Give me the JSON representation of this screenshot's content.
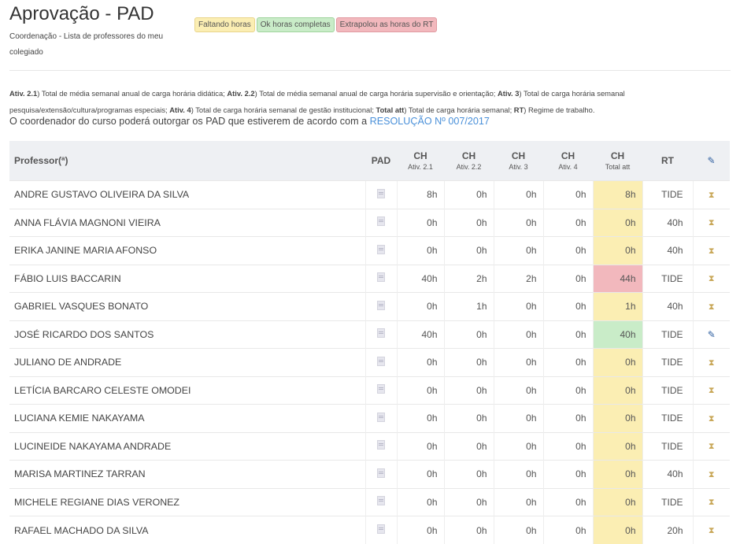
{
  "page": {
    "title": "Aprovação - PAD",
    "subtitle": "Coordenação - Lista de professores do meu colegiado"
  },
  "badges": [
    {
      "label": "Faltando horas",
      "color": "#fbeeb3"
    },
    {
      "label": "Ok horas completas",
      "color": "#c9ecc8"
    },
    {
      "label": "Extrapolou as horas do RT",
      "color": "#f2b8bd"
    }
  ],
  "legend": {
    "a21_key": "Ativ. 2.1",
    "a21_text": ") Total de média semanal anual de carga horária didática; ",
    "a22_key": "Ativ. 2.2",
    "a22_text": ") Total de média semanal anual de carga horária supervisão e orientação; ",
    "a3_key": "Ativ. 3",
    "a3_text": ") Total de carga horária semanal pesquisa/extensão/cultura/programas especiais; ",
    "a4_key": "Ativ. 4",
    "a4_text": ") Total de carga horária semanal de gestão institucional; ",
    "tot_key": "Total att",
    "tot_text": ") Total de carga horária semanal; ",
    "rt_key": "RT",
    "rt_text": ") Regime de trabalho."
  },
  "note": {
    "text": "O coordenador do curso poderá outorgar os PAD que estiverem de acordo com a ",
    "link": "RESOLUÇÃO Nº 007/2017"
  },
  "table": {
    "headers": {
      "professor": "Professor(ª)",
      "pad": "PAD",
      "ch": "CH",
      "a21": "Ativ. 2.1",
      "a22": "Ativ. 2.2",
      "a3": "Ativ. 3",
      "a4": "Ativ. 4",
      "total": "Total att",
      "rt": "RT",
      "action_icon": "pencil-icon"
    },
    "rows": [
      {
        "name": "ANDRE GUSTAVO OLIVEIRA DA SILVA",
        "a21": "8h",
        "a22": "0h",
        "a3": "0h",
        "a4": "0h",
        "total": "8h",
        "status": "yellow",
        "rt": "TIDE",
        "action": "hourglass-icon"
      },
      {
        "name": "ANNA FLÁVIA MAGNONI VIEIRA",
        "a21": "0h",
        "a22": "0h",
        "a3": "0h",
        "a4": "0h",
        "total": "0h",
        "status": "yellow",
        "rt": "40h",
        "action": "hourglass-icon"
      },
      {
        "name": "ERIKA JANINE MARIA AFONSO",
        "a21": "0h",
        "a22": "0h",
        "a3": "0h",
        "a4": "0h",
        "total": "0h",
        "status": "yellow",
        "rt": "40h",
        "action": "hourglass-icon"
      },
      {
        "name": "FÁBIO LUIS BACCARIN",
        "a21": "40h",
        "a22": "2h",
        "a3": "2h",
        "a4": "0h",
        "total": "44h",
        "status": "red",
        "rt": "TIDE",
        "action": "hourglass-icon"
      },
      {
        "name": "GABRIEL VASQUES BONATO",
        "a21": "0h",
        "a22": "1h",
        "a3": "0h",
        "a4": "0h",
        "total": "1h",
        "status": "yellow",
        "rt": "40h",
        "action": "hourglass-icon"
      },
      {
        "name": "JOSÉ RICARDO DOS SANTOS",
        "a21": "40h",
        "a22": "0h",
        "a3": "0h",
        "a4": "0h",
        "total": "40h",
        "status": "green",
        "rt": "TIDE",
        "action": "pencil-icon"
      },
      {
        "name": "JULIANO DE ANDRADE",
        "a21": "0h",
        "a22": "0h",
        "a3": "0h",
        "a4": "0h",
        "total": "0h",
        "status": "yellow",
        "rt": "TIDE",
        "action": "hourglass-icon"
      },
      {
        "name": "LETÍCIA BARCARO CELESTE OMODEI",
        "a21": "0h",
        "a22": "0h",
        "a3": "0h",
        "a4": "0h",
        "total": "0h",
        "status": "yellow",
        "rt": "TIDE",
        "action": "hourglass-icon"
      },
      {
        "name": "LUCIANA KEMIE NAKAYAMA",
        "a21": "0h",
        "a22": "0h",
        "a3": "0h",
        "a4": "0h",
        "total": "0h",
        "status": "yellow",
        "rt": "TIDE",
        "action": "hourglass-icon"
      },
      {
        "name": "LUCINEIDE NAKAYAMA ANDRADE",
        "a21": "0h",
        "a22": "0h",
        "a3": "0h",
        "a4": "0h",
        "total": "0h",
        "status": "yellow",
        "rt": "TIDE",
        "action": "hourglass-icon"
      },
      {
        "name": "MARISA MARTINEZ TARRAN",
        "a21": "0h",
        "a22": "0h",
        "a3": "0h",
        "a4": "0h",
        "total": "0h",
        "status": "yellow",
        "rt": "40h",
        "action": "hourglass-icon"
      },
      {
        "name": "MICHELE REGIANE DIAS VERONEZ",
        "a21": "0h",
        "a22": "0h",
        "a3": "0h",
        "a4": "0h",
        "total": "0h",
        "status": "yellow",
        "rt": "TIDE",
        "action": "hourglass-icon"
      },
      {
        "name": "RAFAEL MACHADO DA SILVA",
        "a21": "0h",
        "a22": "0h",
        "a3": "0h",
        "a4": "0h",
        "total": "0h",
        "status": "yellow",
        "rt": "20h",
        "action": "hourglass-icon"
      }
    ]
  }
}
